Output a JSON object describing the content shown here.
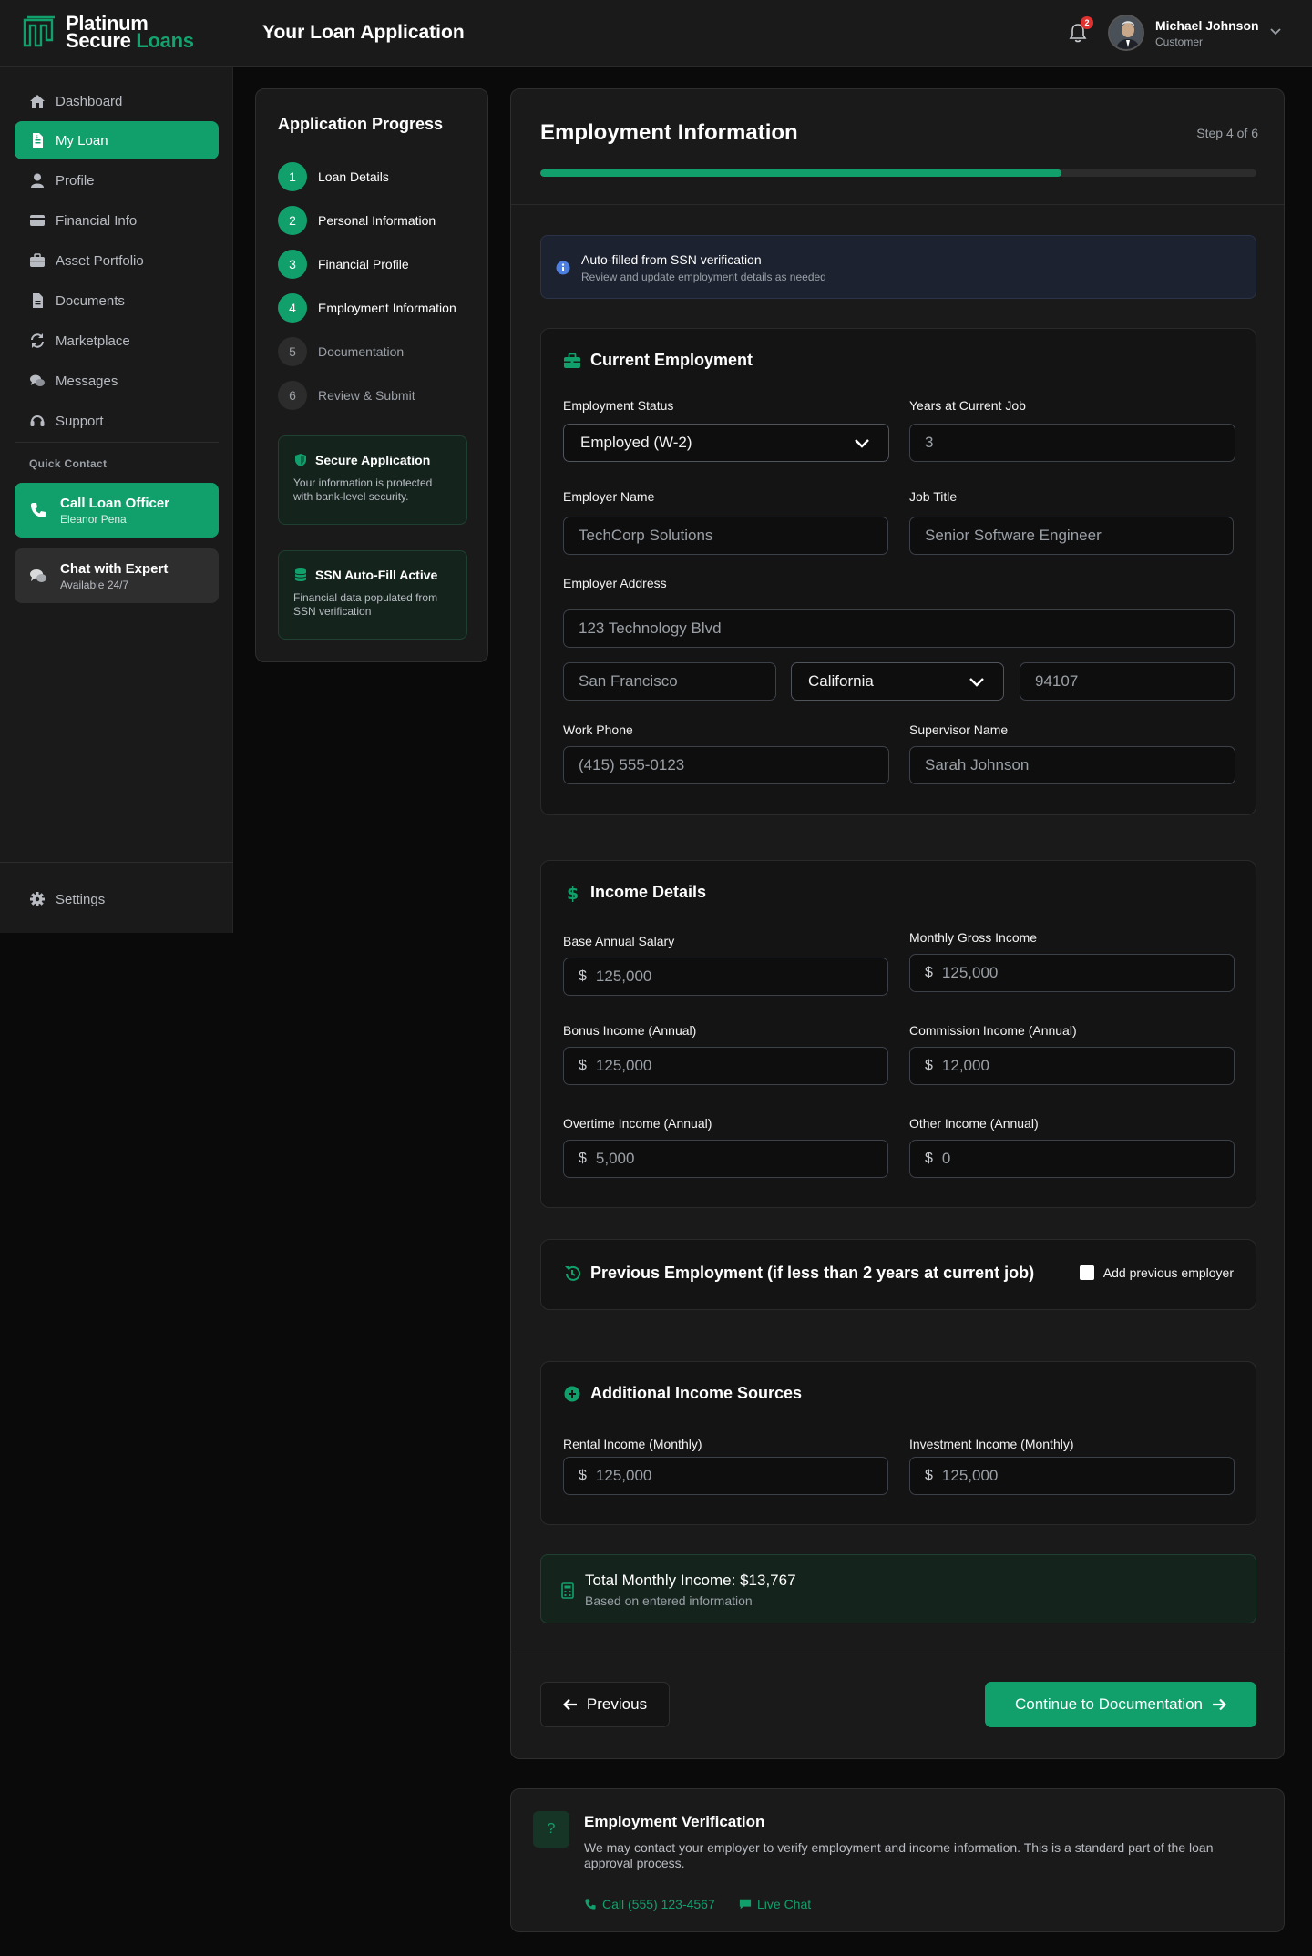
{
  "brand": {
    "line1": "Platinum",
    "line2a": "Secure",
    "line2b": "Loans",
    "accent": "#11a06c"
  },
  "header": {
    "title": "Your Loan Application",
    "notifications": "2",
    "user_name": "Michael Johnson",
    "user_role": "Customer"
  },
  "sidebar": {
    "items": [
      {
        "label": "Dashboard",
        "icon": "home-icon"
      },
      {
        "label": "My Loan",
        "icon": "file-icon",
        "active": true
      },
      {
        "label": "Profile",
        "icon": "user-icon"
      },
      {
        "label": "Financial Info",
        "icon": "credit-card-icon"
      },
      {
        "label": "Asset Portfolio",
        "icon": "briefcase-icon"
      },
      {
        "label": "Documents",
        "icon": "document-icon"
      },
      {
        "label": "Marketplace",
        "icon": "refresh-icon"
      },
      {
        "label": "Messages",
        "icon": "chat-icon"
      },
      {
        "label": "Support",
        "icon": "headset-icon"
      }
    ],
    "quick_contact_label": "Quick Contact",
    "call_title": "Call Loan Officer",
    "call_sub": "Eleanor Pena",
    "chat_title": "Chat with Expert",
    "chat_sub": "Available 24/7",
    "settings_label": "Settings"
  },
  "progress": {
    "title": "Application Progress",
    "steps": [
      {
        "num": "1",
        "label": "Loan Details",
        "done": true
      },
      {
        "num": "2",
        "label": "Personal Information",
        "done": true
      },
      {
        "num": "3",
        "label": "Financial Profile",
        "done": true
      },
      {
        "num": "4",
        "label": "Employment Information",
        "done": true
      },
      {
        "num": "5",
        "label": "Documentation",
        "done": false
      },
      {
        "num": "6",
        "label": "Review & Submit",
        "done": false
      }
    ],
    "secure_title": "Secure Application",
    "secure_body": "Your information is protected with bank-level security.",
    "ssn_title": "SSN Auto-Fill Active",
    "ssn_body": "Financial data populated from SSN verification"
  },
  "main": {
    "title": "Employment Information",
    "step_text": "Step 4 of 6",
    "progress_fraction": 0.728,
    "notice_title": "Auto-filled from SSN verification",
    "notice_sub": "Review and update employment details as needed",
    "current": {
      "title": "Current Employment",
      "status_label": "Employment Status",
      "status_value": "Employed (W-2)",
      "years_label": "Years at Current Job",
      "years_value": "3",
      "employer_label": "Employer Name",
      "employer_value": "TechCorp Solutions",
      "job_label": "Job Title",
      "job_value": "Senior Software Engineer",
      "address_label": "Employer Address",
      "street_value": "123 Technology Blvd",
      "city_value": "San Francisco",
      "state_value": "California",
      "zip_value": "94107",
      "phone_label": "Work Phone",
      "phone_value": "(415) 555-0123",
      "supervisor_label": "Supervisor Name",
      "supervisor_value": "Sarah Johnson"
    },
    "income": {
      "title": "Income Details",
      "currency": "$",
      "base_label": "Base Annual Salary",
      "base_value": "125,000",
      "monthly_label": "Monthly Gross Income",
      "monthly_value": "125,000",
      "bonus_label": "Bonus Income (Annual)",
      "bonus_value": "125,000",
      "commission_label": "Commission Income (Annual)",
      "commission_value": "12,000",
      "overtime_label": "Overtime Income (Annual)",
      "overtime_value": "5,000",
      "other_label": "Other Income (Annual)",
      "other_value": "0"
    },
    "previous": {
      "title": "Previous Employment (if less than 2 years at current job)",
      "checkbox_label": "Add previous employer"
    },
    "additional": {
      "title": "Additional Income Sources",
      "rental_label": "Rental Income (Monthly)",
      "rental_value": "125,000",
      "investment_label": "Investment Income (Monthly)",
      "investment_value": "125,000"
    },
    "total_title": "Total Monthly Income: $13,767",
    "total_sub": "Based on entered information",
    "prev_button": "Previous",
    "next_button": "Continue to Documentation"
  },
  "verification": {
    "icon_glyph": "?",
    "title": "Employment Verification",
    "body": "We may contact your employer to verify employment and income information. This is a standard part of the loan approval process.",
    "call_link": "Call (555) 123-4567",
    "chat_link": "Live Chat"
  }
}
